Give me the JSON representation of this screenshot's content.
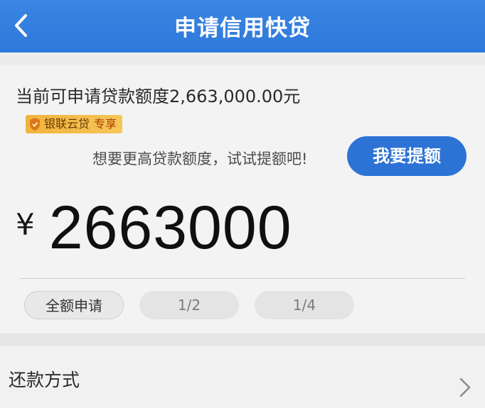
{
  "header": {
    "back_icon": "chevron-left-icon",
    "title": "申请信用快贷"
  },
  "loan": {
    "quota_text": "当前可申请贷款额度2,663,000.00元",
    "badge_brand": "银联云贷",
    "badge_tag": "专享",
    "hint": "想要更高贷款额度，试试提额吧!",
    "raise_button": "我要提额",
    "currency_symbol": "¥",
    "amount": "2663000",
    "options": [
      {
        "label": "全额申请",
        "selected": true
      },
      {
        "label": "1/2",
        "selected": false
      },
      {
        "label": "1/4",
        "selected": false
      }
    ]
  },
  "repayment": {
    "label": "还款方式",
    "chevron_icon": "chevron-right-icon"
  },
  "colors": {
    "header_blue": "#2f78db",
    "button_blue": "#2d73d5",
    "badge_gold": "#f0b33a"
  }
}
